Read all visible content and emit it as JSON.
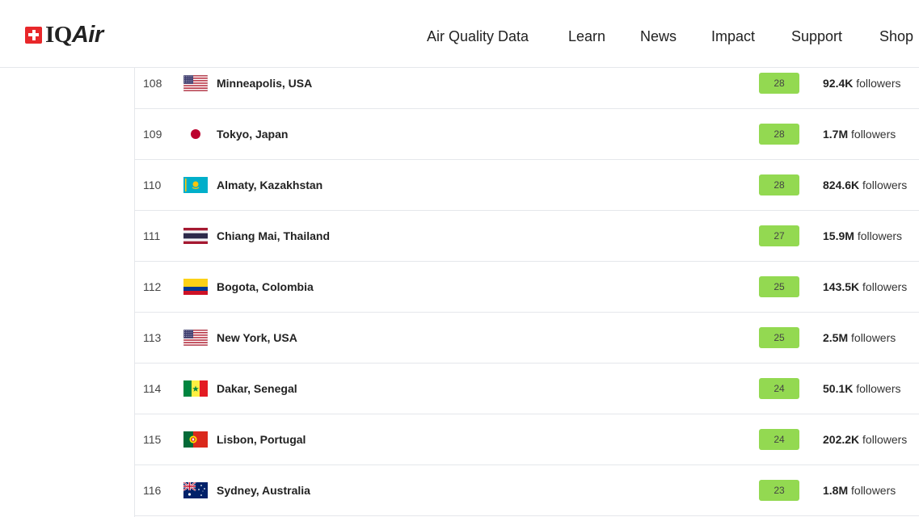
{
  "brand": {
    "logo_iq": "IQ",
    "logo_air": "Air"
  },
  "nav": [
    {
      "label": "Air Quality Data"
    },
    {
      "label": "Learn"
    },
    {
      "label": "News"
    },
    {
      "label": "Impact"
    },
    {
      "label": "Support"
    },
    {
      "label": "Shop"
    }
  ],
  "aqi_color": "#93d951",
  "followers_word": "followers",
  "rankings": [
    {
      "rank": "108",
      "city": "Minneapolis, USA",
      "aqi": "28",
      "followers": "92.4K",
      "flag": "usa-flag-icon"
    },
    {
      "rank": "109",
      "city": "Tokyo, Japan",
      "aqi": "28",
      "followers": "1.7M",
      "flag": "japan-flag-icon"
    },
    {
      "rank": "110",
      "city": "Almaty, Kazakhstan",
      "aqi": "28",
      "followers": "824.6K",
      "flag": "kazakhstan-flag-icon"
    },
    {
      "rank": "111",
      "city": "Chiang Mai, Thailand",
      "aqi": "27",
      "followers": "15.9M",
      "flag": "thailand-flag-icon"
    },
    {
      "rank": "112",
      "city": "Bogota, Colombia",
      "aqi": "25",
      "followers": "143.5K",
      "flag": "colombia-flag-icon"
    },
    {
      "rank": "113",
      "city": "New York, USA",
      "aqi": "25",
      "followers": "2.5M",
      "flag": "usa-flag-icon"
    },
    {
      "rank": "114",
      "city": "Dakar, Senegal",
      "aqi": "24",
      "followers": "50.1K",
      "flag": "senegal-flag-icon"
    },
    {
      "rank": "115",
      "city": "Lisbon, Portugal",
      "aqi": "24",
      "followers": "202.2K",
      "flag": "portugal-flag-icon"
    },
    {
      "rank": "116",
      "city": "Sydney, Australia",
      "aqi": "23",
      "followers": "1.8M",
      "flag": "australia-flag-icon"
    }
  ]
}
